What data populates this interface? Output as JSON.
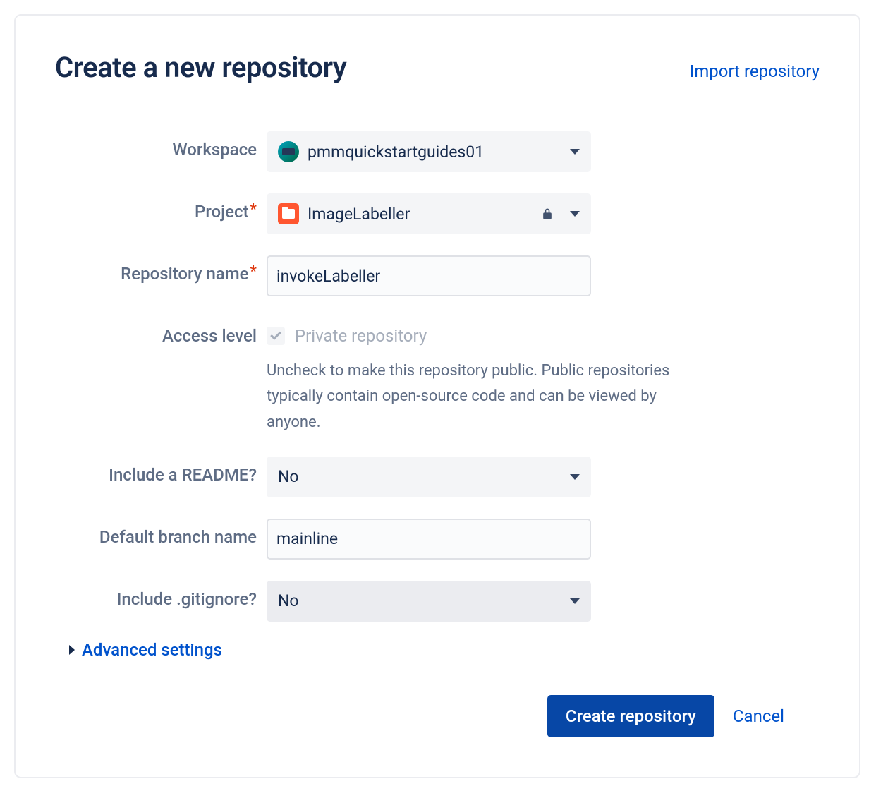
{
  "header": {
    "title": "Create a new repository",
    "import_link": "Import repository"
  },
  "fields": {
    "workspace": {
      "label": "Workspace",
      "value": "pmmquickstartguides01"
    },
    "project": {
      "label": "Project",
      "value": "ImageLabeller"
    },
    "repo_name": {
      "label": "Repository name",
      "value": "invokeLabeller"
    },
    "access": {
      "label": "Access level",
      "checkbox_label": "Private repository",
      "help": "Uncheck to make this repository public. Public repositories typically contain open-source code and can be viewed by anyone."
    },
    "readme": {
      "label": "Include a README?",
      "value": "No"
    },
    "branch": {
      "label": "Default branch name",
      "value": "mainline"
    },
    "gitignore": {
      "label": "Include .gitignore?",
      "value": "No"
    }
  },
  "advanced_label": "Advanced settings",
  "actions": {
    "create": "Create repository",
    "cancel": "Cancel"
  }
}
